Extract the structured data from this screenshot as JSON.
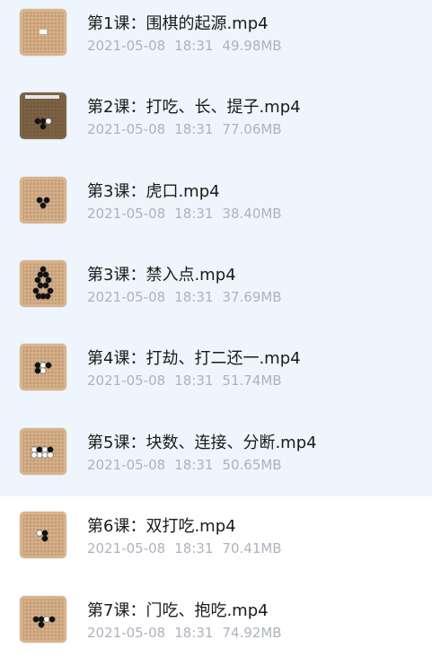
{
  "files": [
    {
      "name": "第1课：围棋的起源.mp4",
      "date": "2021-05-08",
      "time": "18:31",
      "size": "49.98MB"
    },
    {
      "name": "第2课：打吃、长、提子.mp4",
      "date": "2021-05-08",
      "time": "18:31",
      "size": "77.06MB"
    },
    {
      "name": "第3课：虎口.mp4",
      "date": "2021-05-08",
      "time": "18:31",
      "size": "38.40MB"
    },
    {
      "name": "第3课：禁入点.mp4",
      "date": "2021-05-08",
      "time": "18:31",
      "size": "37.69MB"
    },
    {
      "name": "第4课：打劫、打二还一.mp4",
      "date": "2021-05-08",
      "time": "18:31",
      "size": "51.74MB"
    },
    {
      "name": "第5课：块数、连接、分断.mp4",
      "date": "2021-05-08",
      "time": "18:31",
      "size": "50.65MB"
    },
    {
      "name": "第6课：双打吃.mp4",
      "date": "2021-05-08",
      "time": "18:31",
      "size": "70.41MB"
    },
    {
      "name": "第7课：门吃、抱吃.mp4",
      "date": "2021-05-08",
      "time": "18:31",
      "size": "74.92MB"
    }
  ],
  "colors": {
    "selected_background": "#eef5fc",
    "title_text": "#1b1b1b",
    "meta_text": "#adb3bc",
    "board_wood": "#d9b38c"
  },
  "icons": {
    "thumbnail": "go-board-video-thumbnail-icon"
  }
}
